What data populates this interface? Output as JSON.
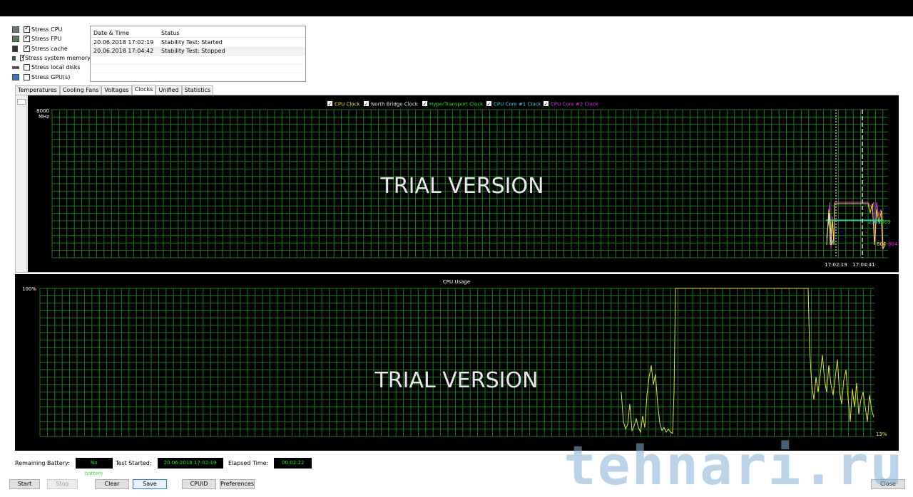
{
  "stress": [
    {
      "label": "Stress CPU",
      "checked": true,
      "icon": "cpu-icon"
    },
    {
      "label": "Stress FPU",
      "checked": true,
      "icon": "fpu-icon"
    },
    {
      "label": "Stress cache",
      "checked": true,
      "icon": "cache-icon"
    },
    {
      "label": "Stress system memory",
      "checked": true,
      "icon": "memory-icon"
    },
    {
      "label": "Stress local disks",
      "checked": false,
      "icon": "disk-icon"
    },
    {
      "label": "Stress GPU(s)",
      "checked": false,
      "icon": "gpu-icon"
    }
  ],
  "log": {
    "headers": [
      "Date & Time",
      "Status"
    ],
    "rows": [
      [
        "20.06.2018 17:02:19",
        "Stability Test: Started"
      ],
      [
        "20.06.2018 17:04:42",
        "Stability Test: Stopped"
      ]
    ]
  },
  "tabs": [
    "Temperatures",
    "Cooling Fans",
    "Voltages",
    "Clocks",
    "Unified",
    "Statistics"
  ],
  "active_tab": "Clocks",
  "clock_chart": {
    "legend": [
      {
        "label": "CPU Clock",
        "color": "#e6e628"
      },
      {
        "label": "North Bridge Clock",
        "color": "#e0e0e0"
      },
      {
        "label": "HyperTransport Clock",
        "color": "#28e628"
      },
      {
        "label": "CPU Core #1 Clock",
        "color": "#28d2e6"
      },
      {
        "label": "CPU Core #2 Clock",
        "color": "#e628e6"
      }
    ],
    "y_top": "8000",
    "y_unit": "MHz",
    "y_bottom": "0",
    "x_labels": [
      "17:02:19",
      "17:04:41"
    ],
    "value_labels": [
      {
        "text": "2009",
        "color": "#28d2e6"
      },
      {
        "text": "2009",
        "color": "#28e628"
      },
      {
        "text": "804",
        "color": "#e6e628"
      },
      {
        "text": "804",
        "color": "#e628e6"
      }
    ],
    "watermark": "TRIAL VERSION"
  },
  "usage_chart": {
    "title": "CPU Usage",
    "y_top": "100%",
    "y_bottom": "0%",
    "current": "13%",
    "watermark": "TRIAL VERSION",
    "line_color": "#e6e628"
  },
  "info": {
    "battery_label": "Remaining Battery:",
    "battery_value": "No battery",
    "started_label": "Test Started:",
    "started_value": "20.06.2018 17:02:19",
    "elapsed_label": "Elapsed Time:",
    "elapsed_value": "00:02:22"
  },
  "buttons": {
    "start": "Start",
    "stop": "Stop",
    "clear": "Clear",
    "save": "Save",
    "cpuid": "CPUID",
    "preferences": "Preferences",
    "close": "Close"
  },
  "watermark_site": "tehnari.ru",
  "grid_color": "#1f7a1f"
}
